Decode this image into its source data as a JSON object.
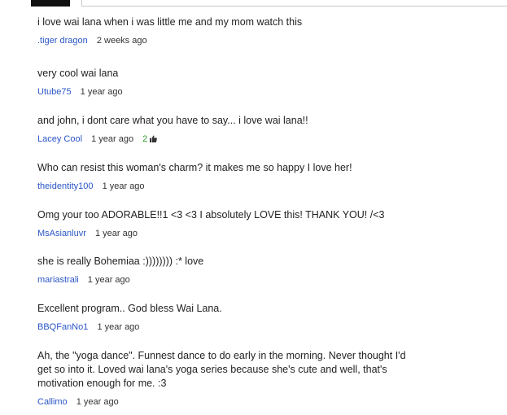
{
  "comments": [
    {
      "text": "i love wai lana when i was little me and my mom watch this",
      "author": ".tiger dragon",
      "time": "2 weeks ago"
    },
    {
      "text": "very cool wai lana",
      "author": "Utube75",
      "time": "1 year ago"
    },
    {
      "text": "and john, i dont care what you have to say... i love wai lana!!",
      "author": "Lacey Cool",
      "time": "1 year ago",
      "likes": "2"
    },
    {
      "text": "Who can resist this woman's charm? it makes me so happy I love her!",
      "author": "theidentity100",
      "time": "1 year ago"
    },
    {
      "text": "Omg your too ADORABLE!!1 <3 <3 I absolutely LOVE this! THANK YOU! /<3",
      "author": "MsAsianluvr",
      "time": "1 year ago"
    },
    {
      "text": "she is really Bohemiaa :)))))))) :* love",
      "author": "mariastrali",
      "time": "1 year ago"
    },
    {
      "text": "Excellent program.. God bless Wai Lana.",
      "author": "BBQFanNo1",
      "time": "1 year ago"
    },
    {
      "text": "Ah, the \"yoga dance\". Funnest dance to do early in the morning. Never thought I'd get so into it. Loved wai lana's yoga series because she's cute and well, that's motivation enough for me. :3",
      "author": "Callimo",
      "time": "1 year ago"
    }
  ],
  "colors": {
    "author": "#2a55c7",
    "likes": "#2e9a2e",
    "text": "#222222"
  },
  "icons": {
    "like": "thumbs-up-icon"
  }
}
